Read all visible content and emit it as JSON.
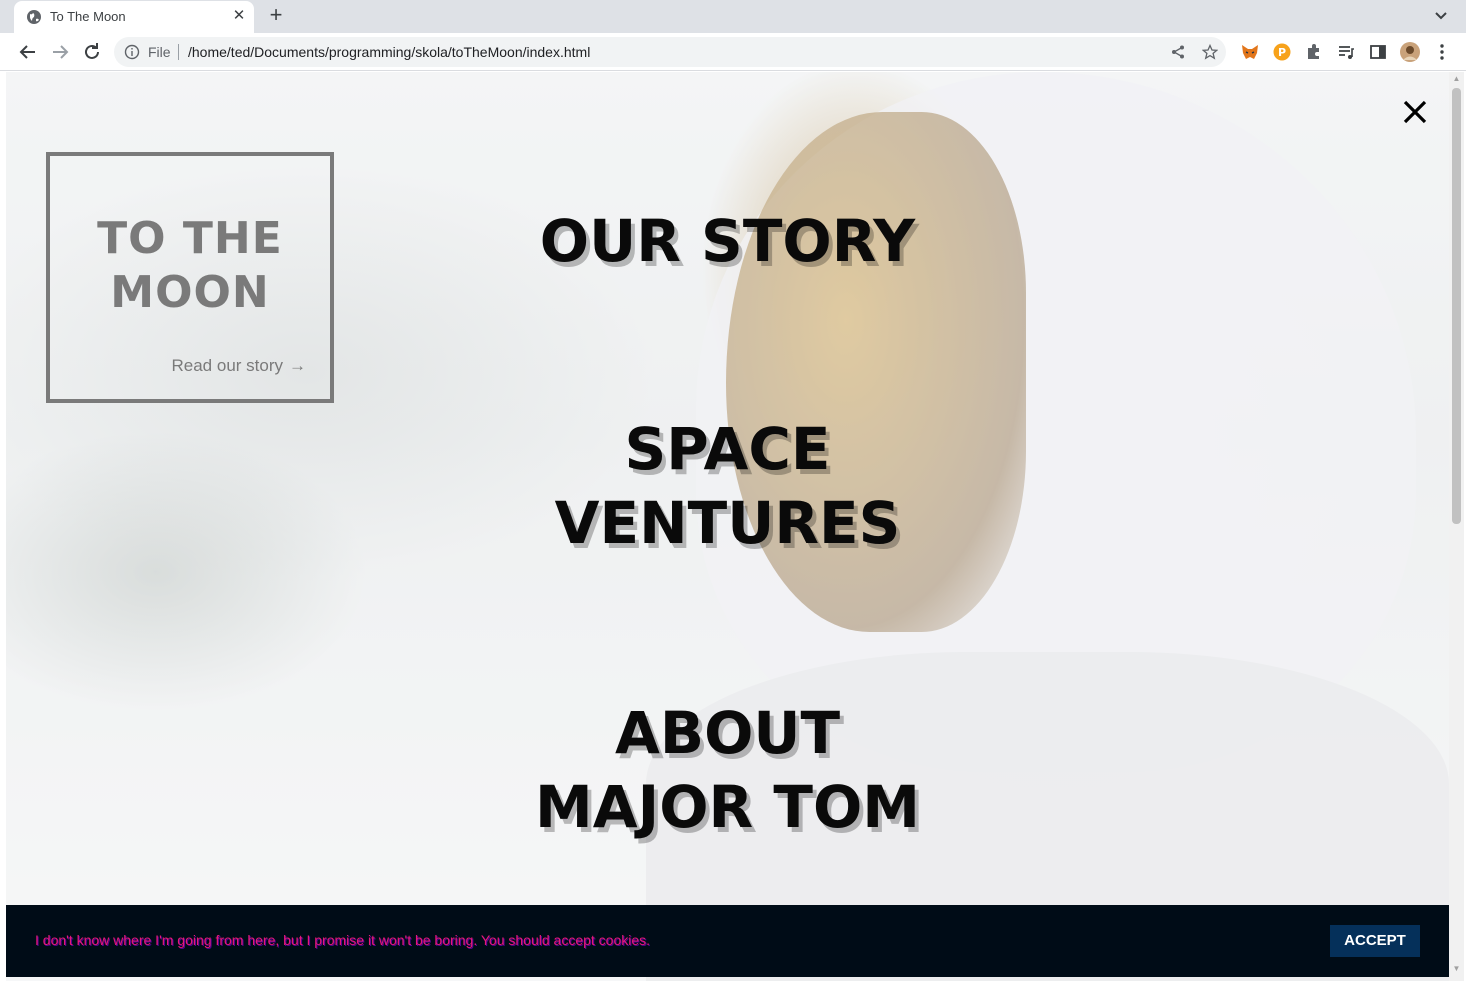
{
  "tab": {
    "title": "To The Moon"
  },
  "toolbar": {
    "scheme": "File",
    "url": "/home/ted/Documents/programming/skola/toTheMoon/index.html"
  },
  "page": {
    "logo": {
      "title_line1": "TO THE",
      "title_line2": "MOON",
      "link_label": "Read our story",
      "link_arrow": "→"
    },
    "menu": [
      {
        "line1": "OUR STORY",
        "line2": ""
      },
      {
        "line1": "SPACE",
        "line2": "VENTURES"
      },
      {
        "line1": "ABOUT",
        "line2": "MAJOR TOM"
      }
    ],
    "cookie": {
      "text": "I don't know where I'm going from here, but I promise it won't be boring. You should accept cookies.",
      "accept_label": "ACCEPT"
    }
  },
  "colors": {
    "cookie_bar": "#000c17",
    "cookie_text": "#e5197a",
    "accept_button": "#05305a",
    "logo_gray": "#7a7a7a"
  },
  "icons": [
    "globe-icon",
    "close-icon",
    "plus-icon",
    "chevron-down-icon",
    "back-icon",
    "forward-icon",
    "reload-icon",
    "info-icon",
    "share-icon",
    "star-icon",
    "metamask-icon",
    "extension-coin-icon",
    "puzzle-icon",
    "media-icon",
    "sidepanel-icon",
    "avatar",
    "more-vert-icon"
  ]
}
